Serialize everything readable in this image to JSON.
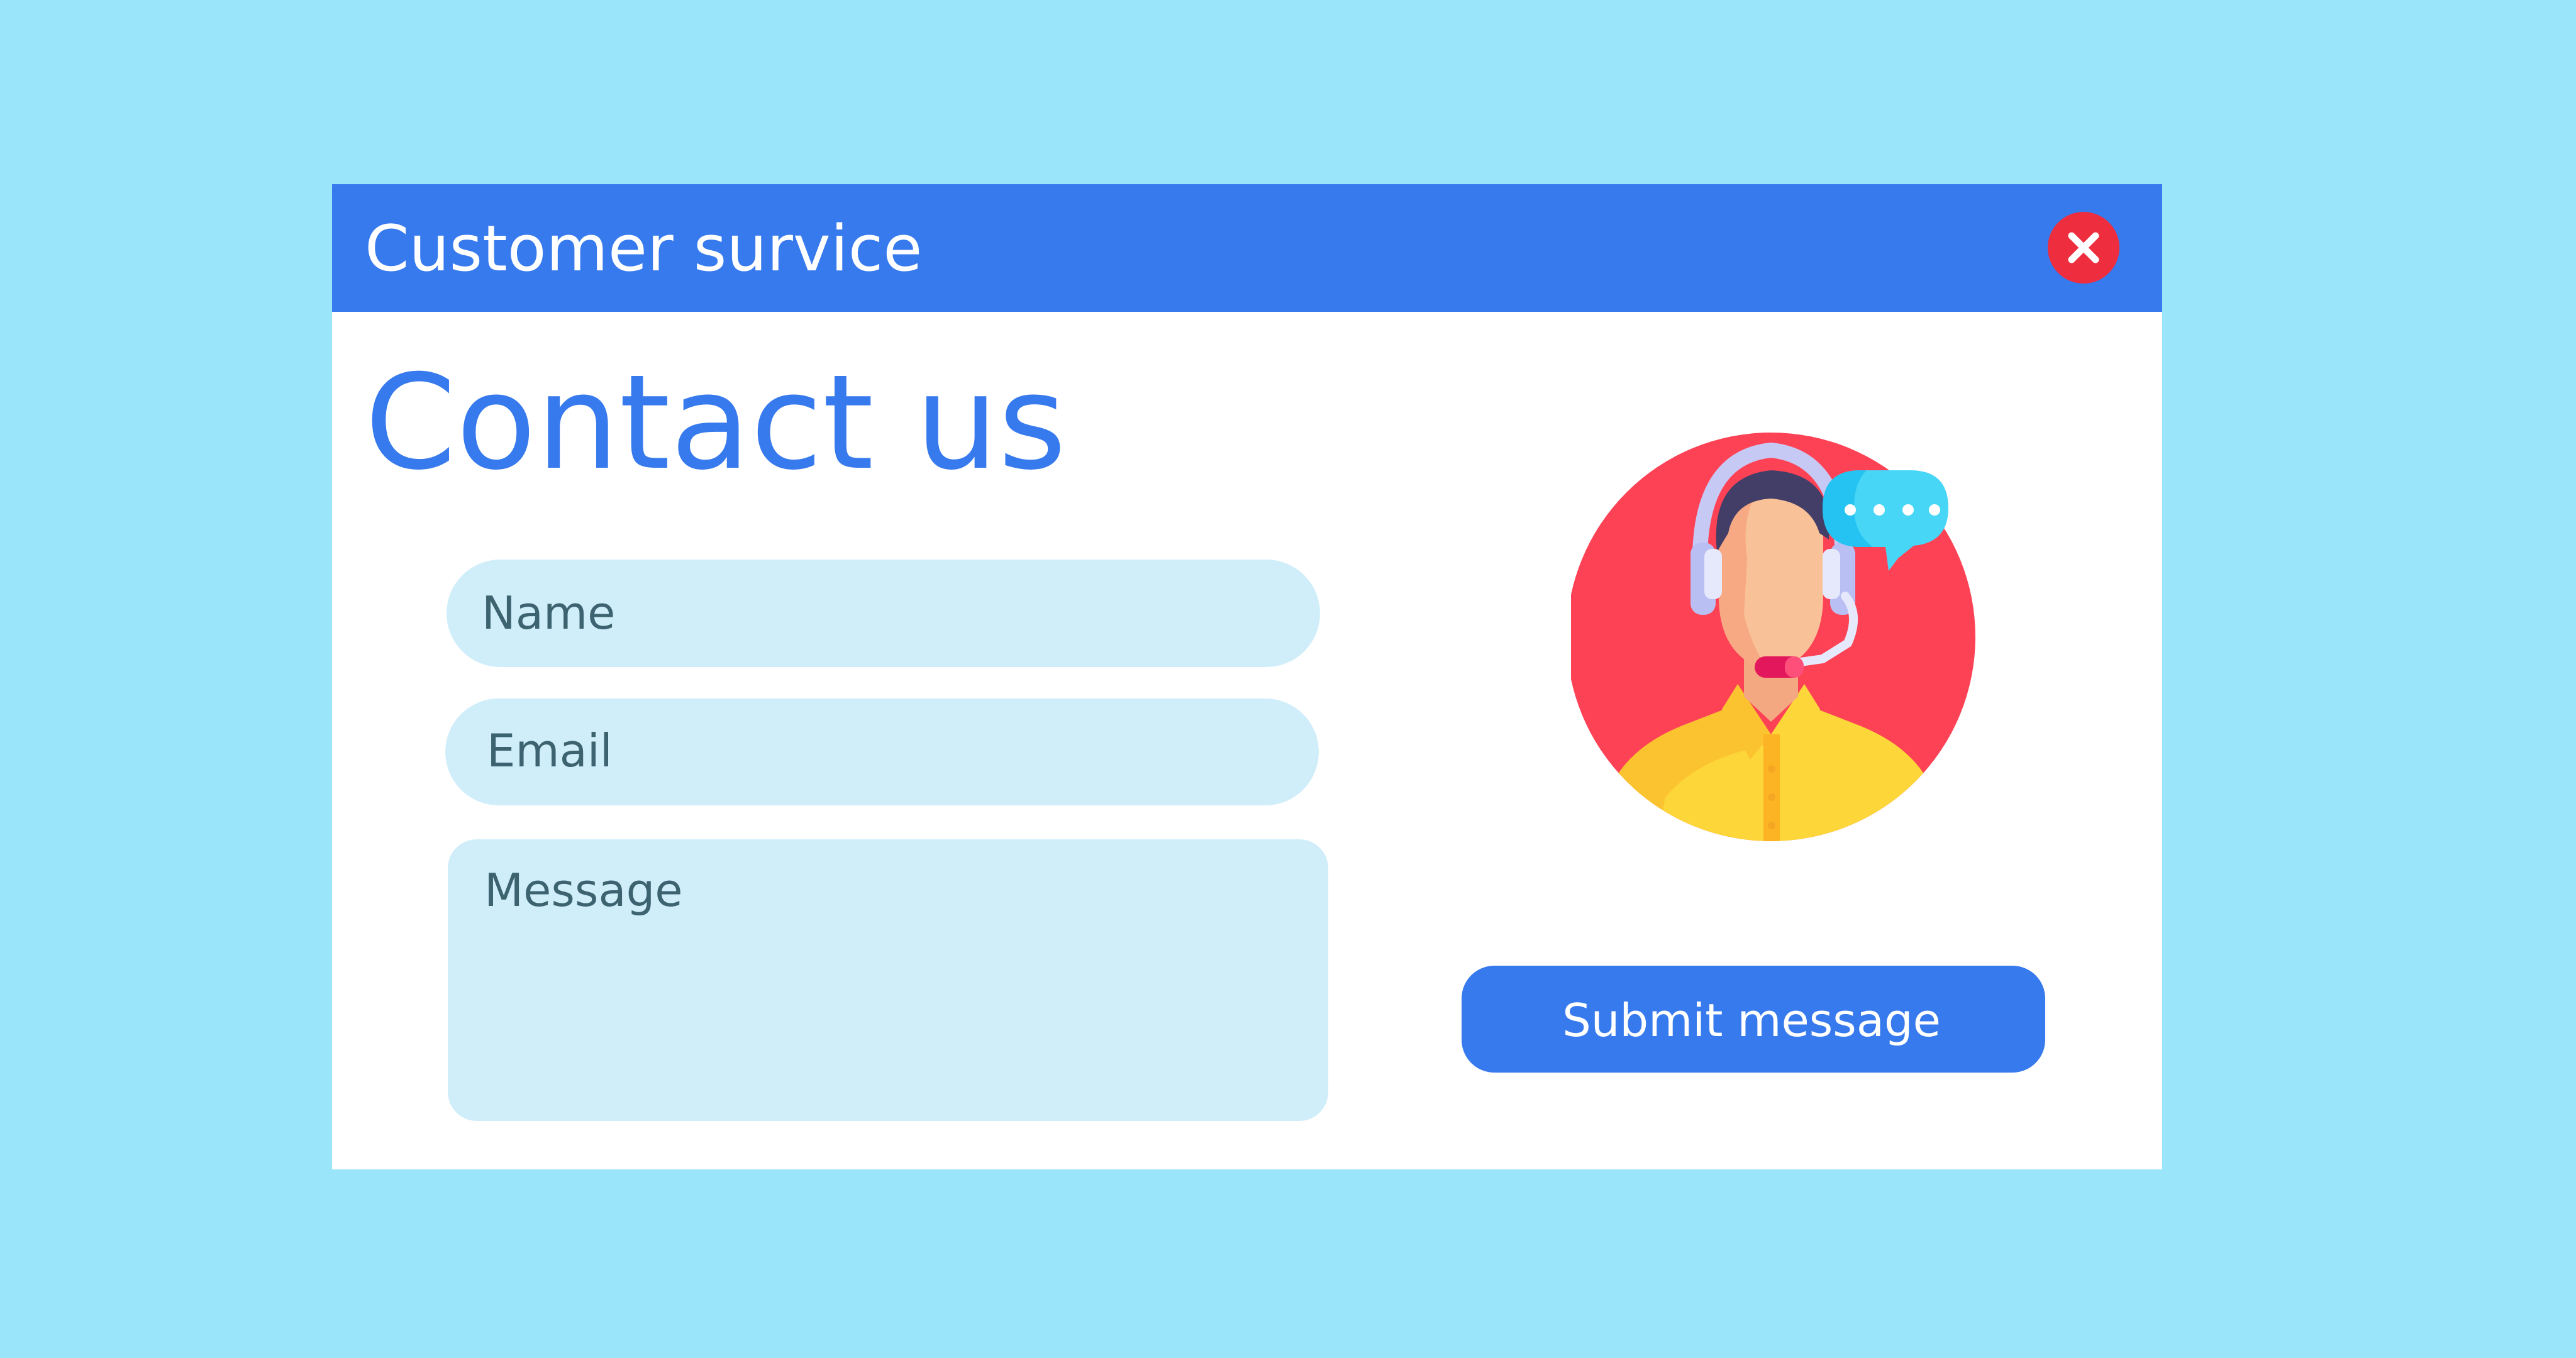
{
  "window": {
    "title": "Customer survice"
  },
  "form": {
    "heading": "Contact us",
    "name_placeholder": "Name",
    "email_placeholder": "Email",
    "message_placeholder": "Message",
    "submit_label": "Submit message"
  },
  "icons": {
    "close": "close-icon",
    "illustration": "customer-support-agent-icon"
  },
  "colors": {
    "background": "#9be5fb",
    "accent": "#377aed",
    "field_background": "#d0eefa",
    "close_button": "#ee2d3e"
  }
}
